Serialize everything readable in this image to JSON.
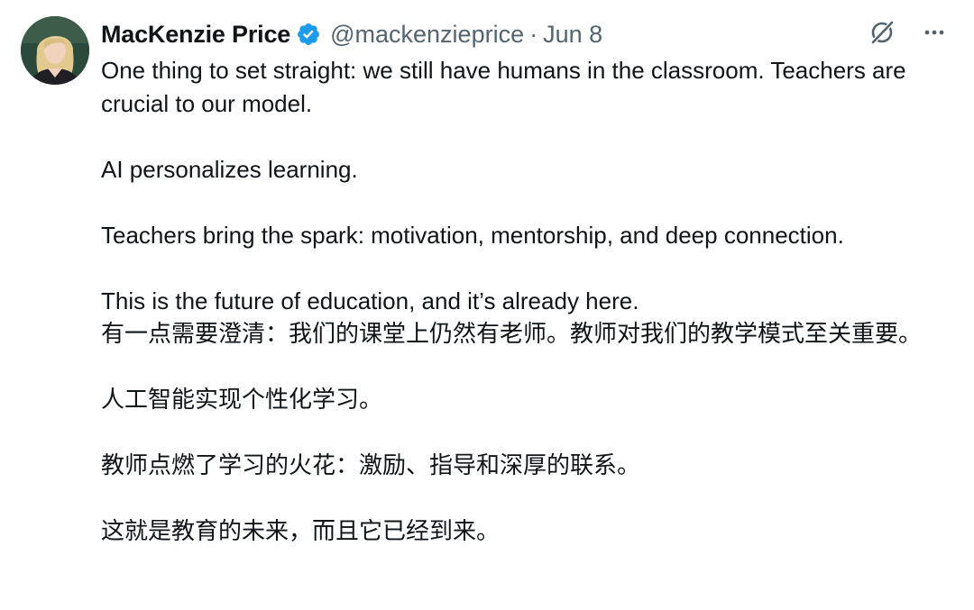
{
  "author": {
    "name": "MacKenzie Price",
    "handle": "@mackenzieprice",
    "separator": "·",
    "date": "Jun 8",
    "verified": true
  },
  "icons": {
    "verified": "verified-badge-icon",
    "grok": "grok-icon",
    "more": "more-options-icon"
  },
  "colors": {
    "verified_blue": "#1d9bf0",
    "secondary_text": "#536471",
    "primary_text": "#0f1419"
  },
  "tweet": {
    "english": {
      "p1": "One thing to set straight: we still have humans in the classroom. Teachers are crucial to our model.",
      "p2": "AI personalizes learning.",
      "p3": "Teachers bring the spark: motivation, mentorship, and deep connection.",
      "p4": "This is the future of education, and it’s already here."
    },
    "chinese": {
      "p1": "有一点需要澄清：我们的课堂上仍然有老师。教师对我们的教学模式至关重要。",
      "p2": "人工智能实现个性化学习。",
      "p3": "教师点燃了学习的火花：激励、指导和深厚的联系。",
      "p4": "这就是教育的未来，而且它已经到来。"
    }
  }
}
